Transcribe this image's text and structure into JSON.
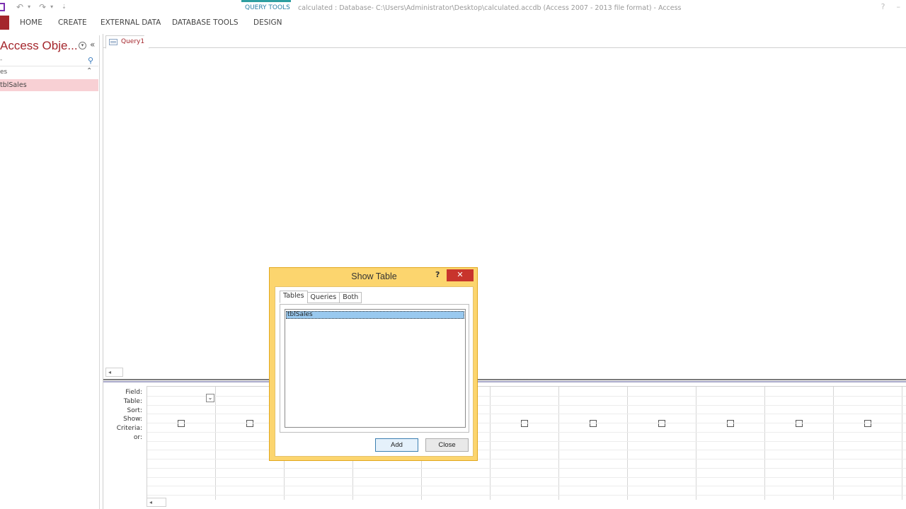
{
  "window": {
    "contextual_tab": "QUERY TOOLS",
    "title": "calculated : Database- C:\\Users\\Administrator\\Desktop\\calculated.accdb (Access 2007 - 2013 file format) - Access",
    "help_glyph": "?",
    "minimize_glyph": "–"
  },
  "qat": {
    "undo_glyph": "↶",
    "redo_glyph": "↷",
    "dropdown_glyph": "▾",
    "customize_glyph": "⇣"
  },
  "ribbon": {
    "tabs": [
      {
        "label": "HOME"
      },
      {
        "label": "CREATE"
      },
      {
        "label": "EXTERNAL DATA"
      },
      {
        "label": "DATABASE TOOLS"
      },
      {
        "label": "DESIGN"
      }
    ]
  },
  "nav_pane": {
    "title": "Access Obje...",
    "dropdown_glyph": "▾",
    "collapse_glyph": "«",
    "search_text": "-",
    "search_icon_glyph": "⚲",
    "group_label": "es",
    "group_collapse_glyph": "⌃",
    "items": [
      {
        "label": "tblSales"
      }
    ]
  },
  "document": {
    "tab_label": "Query1"
  },
  "scroll": {
    "left_arrow": "◂"
  },
  "design_grid": {
    "row_labels": [
      "Field:",
      "Table:",
      "Sort:",
      "Show:",
      "Criteria:",
      "or:"
    ],
    "dropdown_glyph": "⌄"
  },
  "dialog": {
    "title": "Show Table",
    "help": "?",
    "close_glyph": "✕",
    "tabs": [
      {
        "label": "Tables",
        "active": true
      },
      {
        "label": "Queries",
        "active": false
      },
      {
        "label": "Both",
        "active": false
      }
    ],
    "list_items": [
      {
        "label": "tblSales",
        "selected": true
      }
    ],
    "add_label": "Add",
    "close_label": "Close"
  },
  "colors": {
    "accent_red": "#a4262c",
    "contextual_teal": "#2e9ea0",
    "dialog_frame": "#fcd56e",
    "selection_blue": "#99c9ef",
    "nav_selected": "#f8d0d4"
  }
}
